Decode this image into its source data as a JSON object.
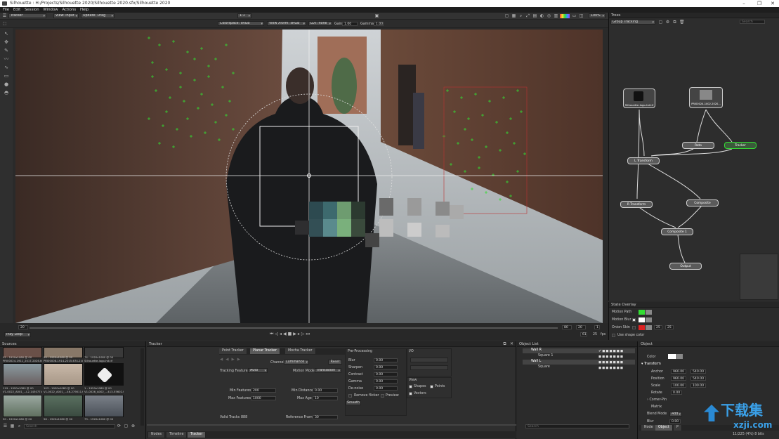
{
  "window": {
    "title": "Silhouette : H:/Projects/Silhouette 2020/Silhouette 2020.sfx/Silhouette 2020",
    "minimize": "–",
    "maximize": "❐",
    "close": "✕"
  },
  "menu": [
    "File",
    "Edit",
    "Session",
    "Window",
    "Actions",
    "Help"
  ],
  "toolbar": {
    "node_select": "Tracker",
    "view": "View: Input",
    "update": "Update: Drag",
    "zoom": "1:1",
    "zoom_pct": "100%"
  },
  "viewer_bar": {
    "colorspace": "Colorspace: sRGB",
    "view_xform": "View Xform: sRGB",
    "lut": "LUT: none",
    "gain_label": "Gain",
    "gain": "1.00",
    "gamma_label": "Gamma",
    "gamma": "1.00"
  },
  "timeline": {
    "frame_current": "20",
    "loop_mode": "Play Loop",
    "frame_end": "80",
    "frame_field": "20",
    "frame_start": "1",
    "frame_a": "61",
    "fps": "25",
    "fps_unit": "fps"
  },
  "sources": {
    "title": "Sources",
    "search_placeholder": "Search",
    "items": [
      {
        "cap": "92 - 1920x1080 @ 00",
        "cap2": "PRI00024-1911_2017-2026.tif"
      },
      {
        "cap": "99 - 1920x1080 @ 00",
        "cap2": "PRI00008-1914-2015-674-2.tif"
      },
      {
        "cap": "74 - 1920x1080 @ 00",
        "cap2": "Silhouette-logo-hd.tif"
      },
      {
        "cap": "119 - 1920x1080 @ 00",
        "cap2": "V1-0022_A001_...L2-143077.tif"
      },
      {
        "cap": "103 - 1920x1080 @ 00",
        "cap2": "V1-0022_A001_...46-279011.tif"
      },
      {
        "cap": "1 - 1920x1080 @ 00",
        "cap2": "V1-0026_A002_...413-55602.tif"
      },
      {
        "cap": "50 - 1920x1080 @ 00",
        "cap2": ""
      },
      {
        "cap": "56 - 1920x1080 @ 00",
        "cap2": ""
      },
      {
        "cap": "73 - 1920x1080 @ 00",
        "cap2": ""
      }
    ]
  },
  "tracker": {
    "title": "Tracker",
    "tabs": [
      "Point Tracker",
      "Planar Tracker",
      "Mocha Tracker"
    ],
    "tracking_features_label": "Tracking Features",
    "tracking_features": "Auto",
    "channel_label": "Channel",
    "channel": "Luminance",
    "reset": "Reset",
    "motion_model_label": "Motion Model",
    "motion_model": "Translation",
    "min_features_label": "Min Features",
    "min_features": "200",
    "max_features_label": "Max Features",
    "max_features": "1000",
    "min_distance_label": "Min Distance",
    "min_distance": "0.00",
    "max_age_label": "Max Age",
    "max_age": "10",
    "valid_tracks_label": "Valid Tracks",
    "valid_tracks": "888",
    "ref_frame_label": "Reference Frame",
    "ref_frame": "30",
    "preproc_title": "Pre-Processing",
    "pre": [
      {
        "l": "Blur",
        "v": "0.00"
      },
      {
        "l": "Sharpen",
        "v": "0.00"
      },
      {
        "l": "Contrast",
        "v": "0.00"
      },
      {
        "l": "Gamma",
        "v": "0.00"
      },
      {
        "l": "De-noise",
        "v": "0.00"
      }
    ],
    "remove_flicker": "Remove flicker",
    "preview": "Preview",
    "smooth": "Smooth",
    "io_title": "I/O",
    "view_title": "View",
    "shapes": "Shapes",
    "points": "Points",
    "vectors": "Vectors",
    "bottom_tabs": [
      "Nodes",
      "Timeline",
      "Tracker"
    ]
  },
  "objectlist": {
    "title": "Object List",
    "items": [
      "Wall R",
      "Square 1",
      "Wall L",
      "Square"
    ],
    "search_placeholder": "Search"
  },
  "trees": {
    "title": "Trees",
    "group": "Group Tracking",
    "search_placeholder": "Search",
    "nodes": [
      "Silhouette-logo-hd.tif",
      "PRI00024-1002-2020...",
      "Roto",
      "Tracker",
      "L Transform",
      "R Transform",
      "Composite",
      "Composite 1",
      "Output"
    ]
  },
  "state_overlay": {
    "title": "State Overlay",
    "motion_path": "Motion Path",
    "motion_blur": "Motion Blur",
    "onion_skin": "Onion Skin",
    "onion_a": "25",
    "onion_b": "25",
    "use_shape_color": "Use shape color"
  },
  "object": {
    "title": "Object",
    "color_label": "Color",
    "transform": "Transform",
    "anchor_label": "Anchor",
    "anchor_x": "960.00",
    "anchor_y": "540.00",
    "position_label": "Position",
    "position_x": "960.00",
    "position_y": "540.00",
    "scale_label": "Scale",
    "scale_x": "100.00",
    "scale_y": "100.00",
    "rotate_label": "Rotate",
    "rotate": "0.00",
    "corner_pin": "Corner-Pin",
    "matrix": "Matrix",
    "blend_label": "Blend Mode",
    "blend": "Add",
    "blur_label": "Blur",
    "blur": "0.00",
    "tabs": [
      "Node",
      "Object",
      "P"
    ]
  },
  "status": {
    "memory": "11/225 (4%) 8 bits"
  },
  "watermark": {
    "text": "下载集",
    "url": "xzji.com"
  },
  "colors": {
    "accent_green": "#33dd33",
    "purple": "#a070e0",
    "red": "#dd2222"
  }
}
